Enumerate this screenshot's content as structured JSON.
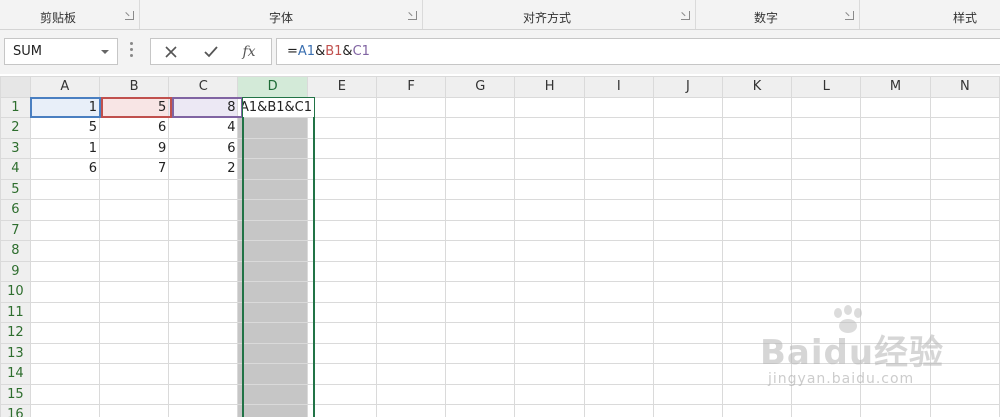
{
  "ribbon": {
    "groups": [
      "剪贴板",
      "字体",
      "对齐方式",
      "数字",
      "样式"
    ]
  },
  "formula_bar": {
    "name_box": "SUM",
    "fx_label": "fx",
    "formula_parts": [
      {
        "text": "=",
        "color": "#222222"
      },
      {
        "text": "A1",
        "color": "#3a6fb0"
      },
      {
        "text": "&",
        "color": "#222222"
      },
      {
        "text": "B1",
        "color": "#c0504d"
      },
      {
        "text": "&",
        "color": "#222222"
      },
      {
        "text": "C1",
        "color": "#8064a2"
      }
    ]
  },
  "sheet": {
    "columns": [
      "A",
      "B",
      "C",
      "D",
      "E",
      "F",
      "G",
      "H",
      "I",
      "J",
      "K",
      "L",
      "M",
      "N"
    ],
    "selected_column": "D",
    "rows": [
      {
        "num": "1",
        "cells": [
          "1",
          "5",
          "8"
        ]
      },
      {
        "num": "2",
        "cells": [
          "5",
          "6",
          "4"
        ]
      },
      {
        "num": "3",
        "cells": [
          "1",
          "9",
          "6"
        ]
      },
      {
        "num": "4",
        "cells": [
          "6",
          "7",
          "2"
        ]
      },
      {
        "num": "5",
        "cells": [
          "",
          "",
          ""
        ]
      },
      {
        "num": "6",
        "cells": [
          "",
          "",
          ""
        ]
      },
      {
        "num": "7",
        "cells": [
          "",
          "",
          ""
        ]
      },
      {
        "num": "8",
        "cells": [
          "",
          "",
          ""
        ]
      },
      {
        "num": "9",
        "cells": [
          "",
          "",
          ""
        ]
      },
      {
        "num": "10",
        "cells": [
          "",
          "",
          ""
        ]
      },
      {
        "num": "11",
        "cells": [
          "",
          "",
          ""
        ]
      },
      {
        "num": "12",
        "cells": [
          "",
          "",
          ""
        ]
      },
      {
        "num": "13",
        "cells": [
          "",
          "",
          ""
        ]
      },
      {
        "num": "14",
        "cells": [
          "",
          "",
          ""
        ]
      },
      {
        "num": "15",
        "cells": [
          "",
          "",
          ""
        ]
      },
      {
        "num": "16",
        "cells": [
          "",
          "",
          ""
        ]
      }
    ],
    "editing_cell_text": "=A1&B1&C1"
  },
  "watermark": {
    "brand": "Baidu经验",
    "url": "jingyan.baidu.com"
  },
  "icons": {
    "cancel": "close-icon",
    "enter": "check-icon",
    "function": "fx-icon"
  }
}
